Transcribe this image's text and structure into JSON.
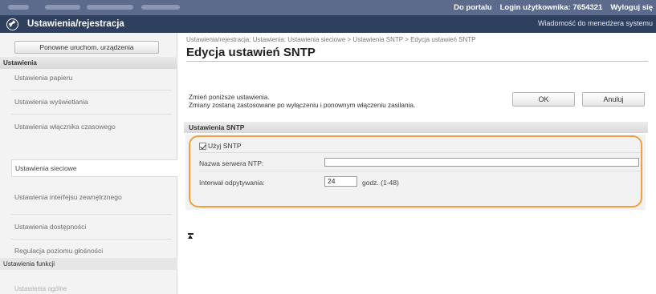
{
  "topbar": {
    "portal_link": "Do portalu",
    "login_label": "Login użytkownika:",
    "login_value": "7654321",
    "logout_link": "Wyloguj się"
  },
  "header": {
    "logo_icon": "settings-registration-icon",
    "title": "Ustawienia/rejestracja",
    "message_link": "Wiadomość do menedżera systemu"
  },
  "sidebar": {
    "restart_button": "Ponowne uruchom. urządzenia",
    "section_settings": "Ustawienia",
    "items": [
      "Ustawienia papieru",
      "Ustawienia wyświetlania",
      "Ustawienia włącznika czasowego",
      "Ustawienia sieciowe",
      "Ustawienia interfejsu zewnętrznego",
      "Ustawienia dostępności",
      "Regulacja poziomu głośności"
    ],
    "section_functions": "Ustawienia funkcji",
    "faded_item": "Ustawienia ogólne"
  },
  "main": {
    "breadcrumb": "Ustawienia/rejestracja: Ustawienia: Ustawienia sieciowe > Ustawienia SNTP > Edycja ustawień SNTP",
    "title": "Edycja ustawień SNTP",
    "desc1": "Zmień poniższe ustawienia.",
    "desc2": "Zmiany zostaną zastosowane po wyłączeniu i ponownym włączeniu zasilania.",
    "ok_button": "OK",
    "cancel_button": "Anuluj",
    "section_title": "Ustawienia SNTP",
    "use_sntp_label": "Użyj SNTP",
    "use_sntp_checked": true,
    "ntp_server_label": "Nazwa serwera NTP:",
    "ntp_server_value": "",
    "interval_label": "Interwał odpytywania:",
    "interval_value": "24",
    "interval_unit": "godz. (1-48)",
    "top_icon": "scroll-to-top-icon",
    "highlight_color": "#f0a03c"
  }
}
